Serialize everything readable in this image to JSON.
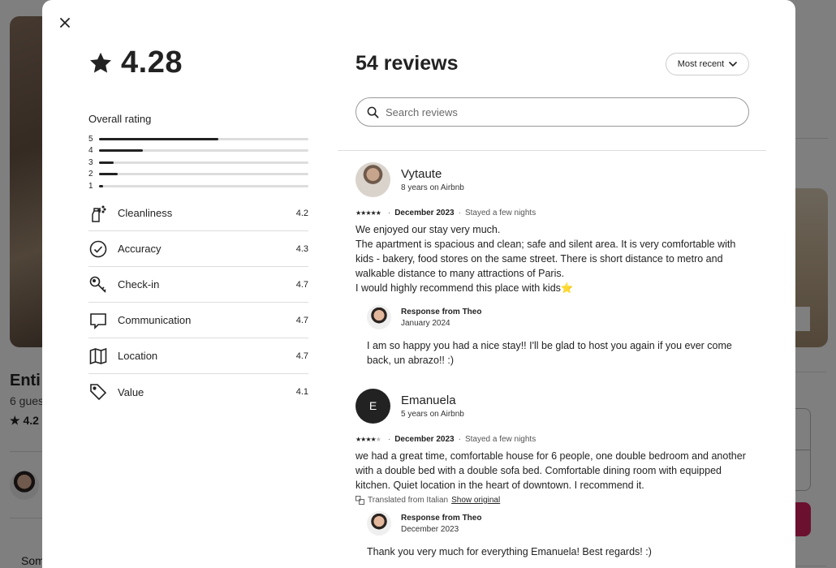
{
  "background": {
    "title": "Enti",
    "subtitle": "6 gues",
    "rating": "4.2",
    "sort_text": "Som",
    "show_button": "s"
  },
  "modal": {
    "close_label": "×",
    "rating_value": "4.28",
    "overall_label": "Overall rating",
    "distribution": [
      {
        "stars": "5",
        "fraction": 0.57
      },
      {
        "stars": "4",
        "fraction": 0.21
      },
      {
        "stars": "3",
        "fraction": 0.07
      },
      {
        "stars": "2",
        "fraction": 0.09
      },
      {
        "stars": "1",
        "fraction": 0.02
      }
    ],
    "categories": [
      {
        "icon": "spray-bottle-icon",
        "name": "Cleanliness",
        "score": "4.2"
      },
      {
        "icon": "check-circle-icon",
        "name": "Accuracy",
        "score": "4.3"
      },
      {
        "icon": "key-icon",
        "name": "Check-in",
        "score": "4.7"
      },
      {
        "icon": "message-bubble-icon",
        "name": "Communication",
        "score": "4.7"
      },
      {
        "icon": "map-icon",
        "name": "Location",
        "score": "4.7"
      },
      {
        "icon": "tag-icon",
        "name": "Value",
        "score": "4.1"
      }
    ],
    "reviews_title": "54 reviews",
    "sort_label": "Most recent",
    "search_placeholder": "Search reviews",
    "reviews": [
      {
        "name": "Vytaute",
        "tenure": "8 years on Airbnb",
        "rating": 5,
        "date": "December 2023",
        "stay": "Stayed a few nights",
        "body": "We enjoyed our stay very much.\nThe apartment is spacious and clean; safe and silent area. It is very comfortable with kids - bakery, food stores on the same street. There is short distance to metro and walkable distance to many attractions of Paris.\nI would highly recommend this place with kids⭐",
        "response_title": "Response from Theo",
        "response_date": "January 2024",
        "response_body": "I am so happy you had a nice stay!! I'll be glad to host you again if you ever come back, un abrazo!! :)"
      },
      {
        "name": "Emanuela",
        "initial": "E",
        "tenure": "5 years on Airbnb",
        "rating": 4,
        "date": "December 2023",
        "stay": "Stayed a few nights",
        "body": "we had a great time, comfortable house for 6 people, one double bedroom and another with a double bed with a double sofa bed. Comfortable dining room with equipped kitchen. Quiet location in the heart of downtown. I recommend it.",
        "translated_note": "Translated from Italian",
        "show_original": "Show original",
        "response_title": "Response from Theo",
        "response_date": "December 2023",
        "response_body": "Thank you very much for everything Emanuela! Best regards! :)"
      }
    ]
  }
}
